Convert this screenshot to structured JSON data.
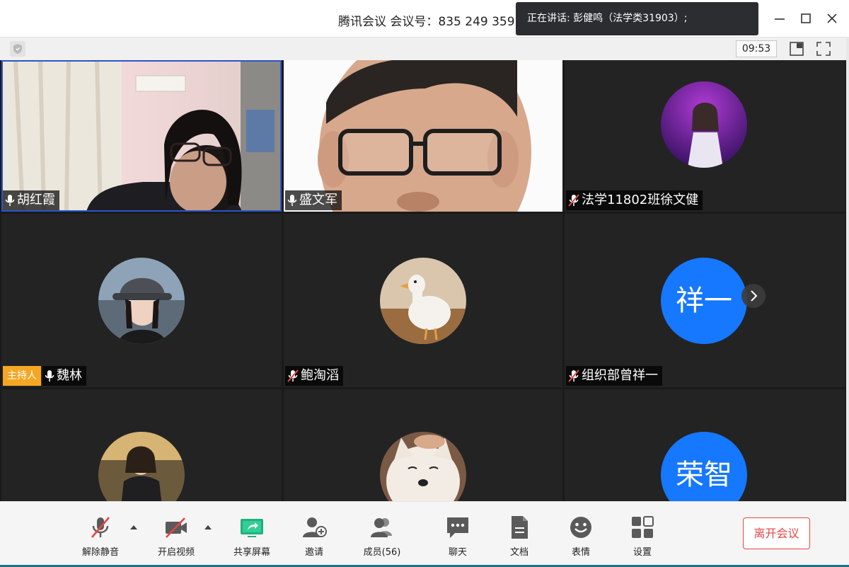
{
  "window": {
    "title": "腾讯会议 会议号：835 249 359",
    "speaking_notice": "正在讲话: 彭健鸣（法学类31903）;"
  },
  "infobar": {
    "time": "09:53"
  },
  "participants": [
    {
      "name": "胡红霞",
      "mic": "on",
      "kind": "video",
      "active": true
    },
    {
      "name": "盛文军",
      "mic": "on",
      "kind": "video"
    },
    {
      "name": "法学11802班徐文健",
      "mic": "muted",
      "kind": "avatar-photo"
    },
    {
      "name": "魏林",
      "mic": "on",
      "kind": "avatar-photo",
      "host_badge": "主持人"
    },
    {
      "name": "鲍淘滔",
      "mic": "muted",
      "kind": "avatar-photo"
    },
    {
      "name": "组织部曾祥一",
      "mic": "muted",
      "kind": "avatar-text",
      "avatar_text": "祥一"
    },
    {
      "name": "",
      "kind": "avatar-photo"
    },
    {
      "name": "",
      "kind": "avatar-photo"
    },
    {
      "name": "",
      "kind": "avatar-text",
      "avatar_text": "荣智"
    }
  ],
  "toolbar": {
    "unmute": "解除静音",
    "start_video": "开启视频",
    "share_screen": "共享屏幕",
    "invite": "邀请",
    "members": "成员(56)",
    "chat": "聊天",
    "docs": "文档",
    "reactions": "表情",
    "settings": "设置",
    "leave": "离开会议"
  },
  "colors": {
    "accent_blue": "#1677ff",
    "host_orange": "#f5a623",
    "leave_red": "#e64545",
    "muted_red": "#e64545",
    "share_green": "#22b07d"
  }
}
